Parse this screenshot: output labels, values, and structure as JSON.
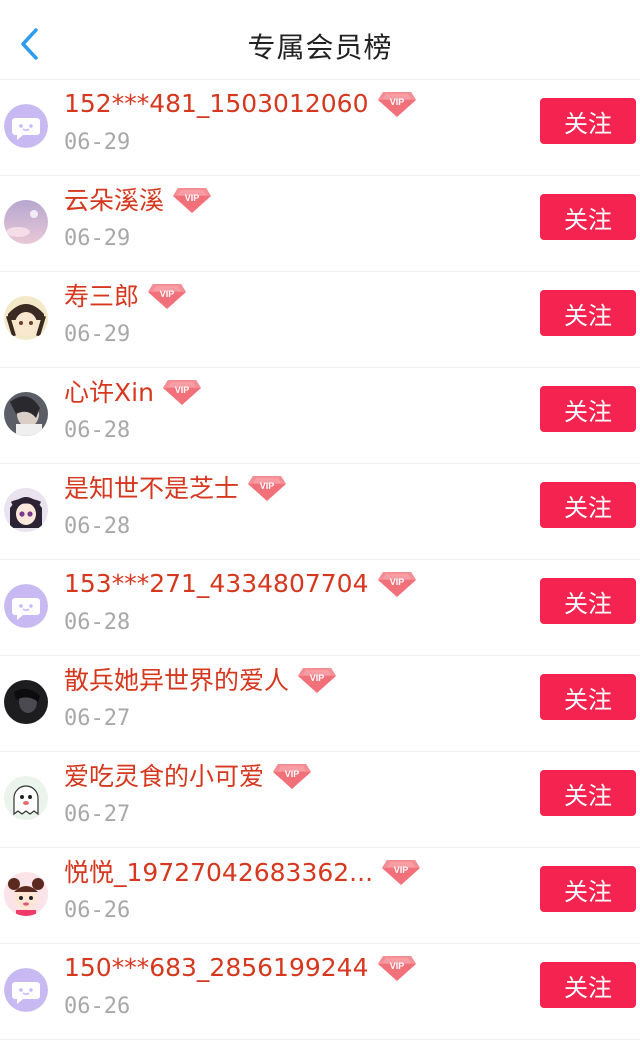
{
  "header": {
    "title": "专属会员榜",
    "back_icon": "chevron-left-icon"
  },
  "colors": {
    "name": "#d6381f",
    "follow_button": "#f5234f",
    "date": "#a8a8a8",
    "back_icon": "#2f9cf0"
  },
  "members": [
    {
      "name": "152***481_1503012060",
      "date": "06-29",
      "avatar": "default-chat-avatar",
      "badge": "VIP",
      "follow_label": "关注"
    },
    {
      "name": "云朵溪溪",
      "date": "06-29",
      "avatar": "sky-photo-avatar",
      "badge": "VIP",
      "follow_label": "关注"
    },
    {
      "name": "寿三郎",
      "date": "06-29",
      "avatar": "anime-character-avatar",
      "badge": "VIP",
      "follow_label": "关注"
    },
    {
      "name": "心许Xin",
      "date": "06-28",
      "avatar": "person-photo-avatar",
      "badge": "VIP",
      "follow_label": "关注"
    },
    {
      "name": "是知世不是芝士",
      "date": "06-28",
      "avatar": "anime-girl-avatar",
      "badge": "VIP",
      "follow_label": "关注"
    },
    {
      "name": "153***271_4334807704",
      "date": "06-28",
      "avatar": "default-chat-avatar",
      "badge": "VIP",
      "follow_label": "关注"
    },
    {
      "name": "散兵她异世界的爱人",
      "date": "06-27",
      "avatar": "dark-photo-avatar",
      "badge": "VIP",
      "follow_label": "关注"
    },
    {
      "name": "爱吃灵食的小可爱",
      "date": "06-27",
      "avatar": "cartoon-ghost-avatar",
      "badge": "VIP",
      "follow_label": "关注"
    },
    {
      "name": "悦悦_19727042683362...",
      "date": "06-26",
      "avatar": "cartoon-girl-avatar",
      "badge": "VIP",
      "follow_label": "关注"
    },
    {
      "name": "150***683_2856199244",
      "date": "06-26",
      "avatar": "default-chat-avatar",
      "badge": "VIP",
      "follow_label": "关注"
    }
  ]
}
